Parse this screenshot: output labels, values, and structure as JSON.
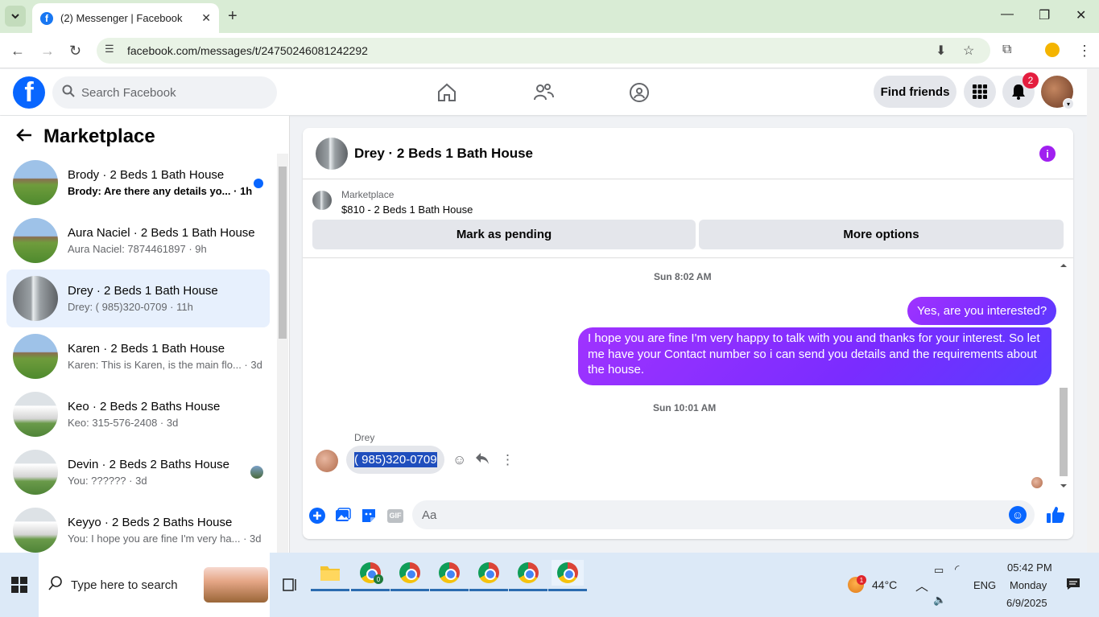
{
  "browser": {
    "tab_title": "(2) Messenger | Facebook",
    "url": "facebook.com/messages/t/24750246081242292"
  },
  "fb": {
    "search_placeholder": "Search Facebook",
    "find_friends": "Find friends",
    "notif_count": "2"
  },
  "left": {
    "title": "Marketplace",
    "conversations": [
      {
        "name": "Brody · 2 Beds 1 Bath House",
        "preview": "Brody: Are there any details yo... · 1h",
        "unread": true
      },
      {
        "name": "Aura Naciel · 2 Beds 1 Bath House",
        "preview": "Aura Naciel: 7874461897 · 9h"
      },
      {
        "name": "Drey · 2 Beds 1 Bath House",
        "preview": "Drey: ( 985)320-0709 · 11h",
        "active": true
      },
      {
        "name": "Karen · 2 Beds 1 Bath House",
        "preview": "Karen: This is Karen, is the main flo... · 3d"
      },
      {
        "name": "Keo · 2 Beds 2 Baths House",
        "preview": "Keo: 315-576-2408 · 3d"
      },
      {
        "name": "Devin · 2 Beds 2 Baths House",
        "preview": "You: ?????? · 3d"
      },
      {
        "name": "Keyyo · 2 Beds 2 Baths House",
        "preview": "You: I hope you are fine I'm very ha... · 3d"
      }
    ]
  },
  "chat": {
    "title": "Drey · 2 Beds 1 Bath House",
    "marketplace_label": "Marketplace",
    "listing": "$810 - 2 Beds 1 Bath House",
    "mark_pending": "Mark as pending",
    "more_options": "More options",
    "ts1": "Sun 8:02 AM",
    "msg1": "Yes, are you interested?",
    "msg2": "I hope you are fine I'm very happy to talk with you and thanks for your interest. So let me have your Contact number so i can send you details and the requirements about the house.",
    "ts2": "Sun 10:01 AM",
    "sender": "Drey",
    "msg3": "( 985)320-0709",
    "composer_placeholder": "Aa",
    "gif_label": "GIF"
  },
  "taskbar": {
    "search_placeholder": "Type here to search",
    "temperature": "44°C",
    "weather_badge": "1",
    "language": "ENG",
    "time": "05:42 PM",
    "day": "Monday",
    "date": "6/9/2025",
    "chrome_badge": "0"
  }
}
